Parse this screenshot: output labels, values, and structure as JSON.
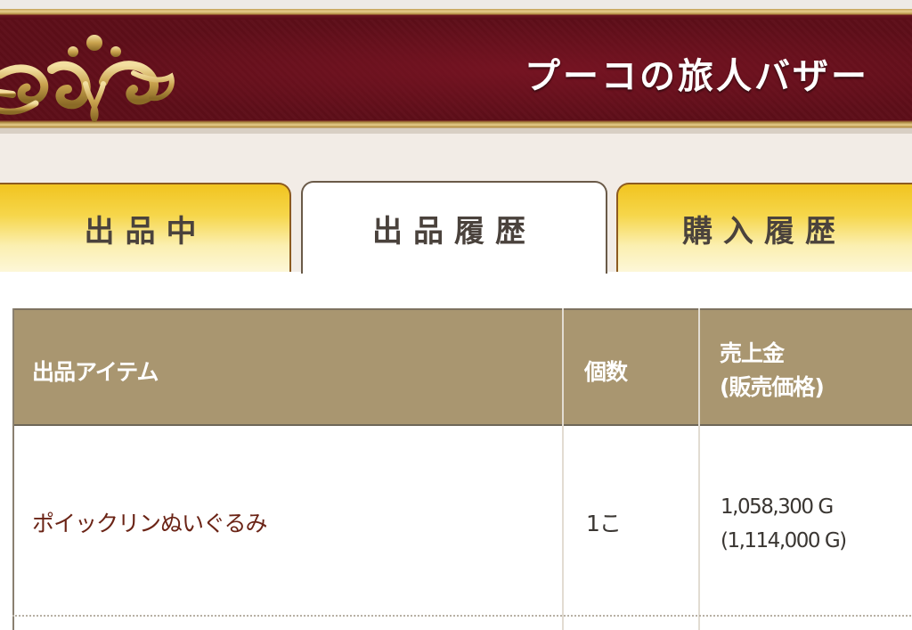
{
  "header": {
    "title": "プーコの旅人バザー"
  },
  "tabs": [
    {
      "label": "出品中",
      "active": false
    },
    {
      "label": "出品履歴",
      "active": true
    },
    {
      "label": "購入履歴",
      "active": false
    }
  ],
  "table": {
    "columns": {
      "item": "出品アイテム",
      "quantity": "個数",
      "sales_line1": "売上金",
      "sales_line2": "(販売価格)"
    },
    "rows": [
      {
        "item": "ポイックリンぬいぐるみ",
        "quantity": "1こ",
        "sales": "1,058,300 G",
        "price": "(1,114,000 G)"
      }
    ]
  },
  "colors": {
    "banner": "#5c0d17",
    "gold_trim": "#c8a656",
    "tab_active_bg": "#ffffff",
    "tab_inactive_bg": "#f1c420",
    "table_header_bg": "#a99670",
    "item_link": "#6b2416"
  },
  "icons": {
    "banner_ornament": "gold-scroll-ornament"
  }
}
